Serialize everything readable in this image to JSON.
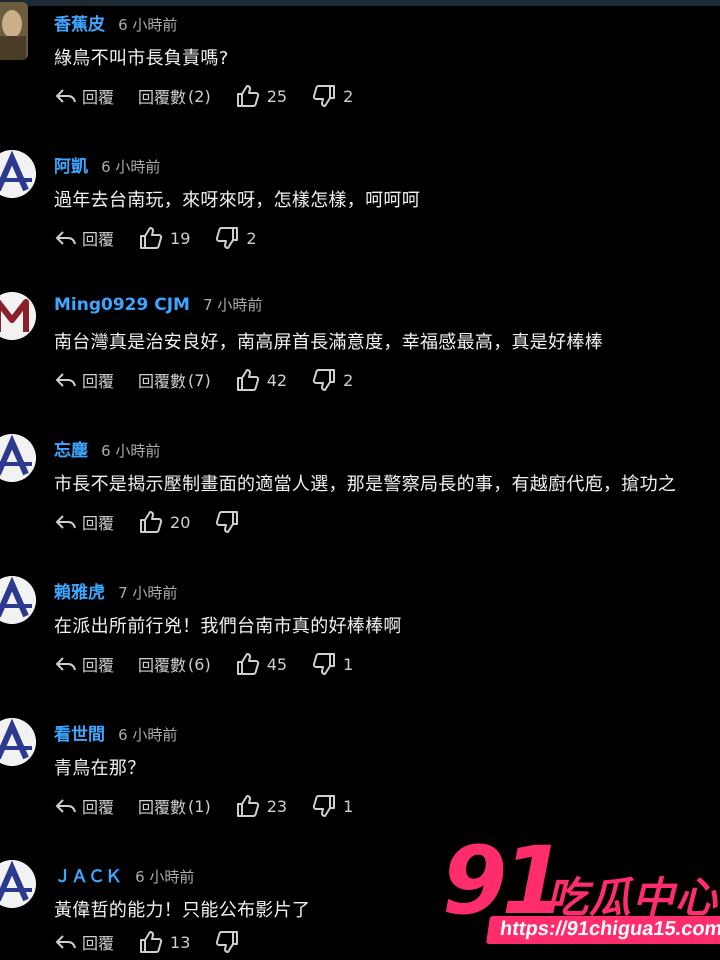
{
  "actions": {
    "reply_label": "回覆",
    "replies_label": "回覆數"
  },
  "comments": [
    {
      "author": "香蕉皮",
      "time": "6 小時前",
      "text": "綠鳥不叫市長負責嗎?",
      "replies": "(2)",
      "likes": "25",
      "dislikes": "2",
      "avatar": "photo"
    },
    {
      "author": "阿凱",
      "time": "6 小時前",
      "text": "過年去台南玩，來呀來呀，怎樣怎樣，呵呵呵",
      "replies": "",
      "likes": "19",
      "dislikes": "2",
      "avatar": "A"
    },
    {
      "author": "Ming0929 CJM",
      "time": "7 小時前",
      "text": "南台灣真是治安良好，南高屏首長滿意度，幸福感最高，真是好棒棒",
      "replies": "(7)",
      "likes": "42",
      "dislikes": "2",
      "avatar": "M"
    },
    {
      "author": "忘塵",
      "time": "6 小時前",
      "text": "市長不是揭示壓制畫面的適當人選，那是警察局長的事，有越廚代庖，搶功之",
      "replies": "",
      "likes": "20",
      "dislikes": "",
      "avatar": "A"
    },
    {
      "author": "賴雅虎",
      "time": "7 小時前",
      "text": "在派出所前行兇！我們台南市真的好棒棒啊",
      "replies": "(6)",
      "likes": "45",
      "dislikes": "1",
      "avatar": "A"
    },
    {
      "author": "看世間",
      "time": "6 小時前",
      "text": "青鳥在那？",
      "replies": "(1)",
      "likes": "23",
      "dislikes": "1",
      "avatar": "A"
    },
    {
      "author": "ＪＡＣＫ",
      "time": "6 小時前",
      "text": "黃偉哲的能力！只能公布影片了",
      "replies": "",
      "likes": "13",
      "dislikes": "",
      "avatar": "A"
    }
  ],
  "watermark": {
    "number": "91",
    "brand": "吃瓜中心",
    "url": "https://91chigua15.com"
  },
  "colors": {
    "background": "#000000",
    "author": "#3ea6ff",
    "watermark": "#ff2d6b"
  }
}
